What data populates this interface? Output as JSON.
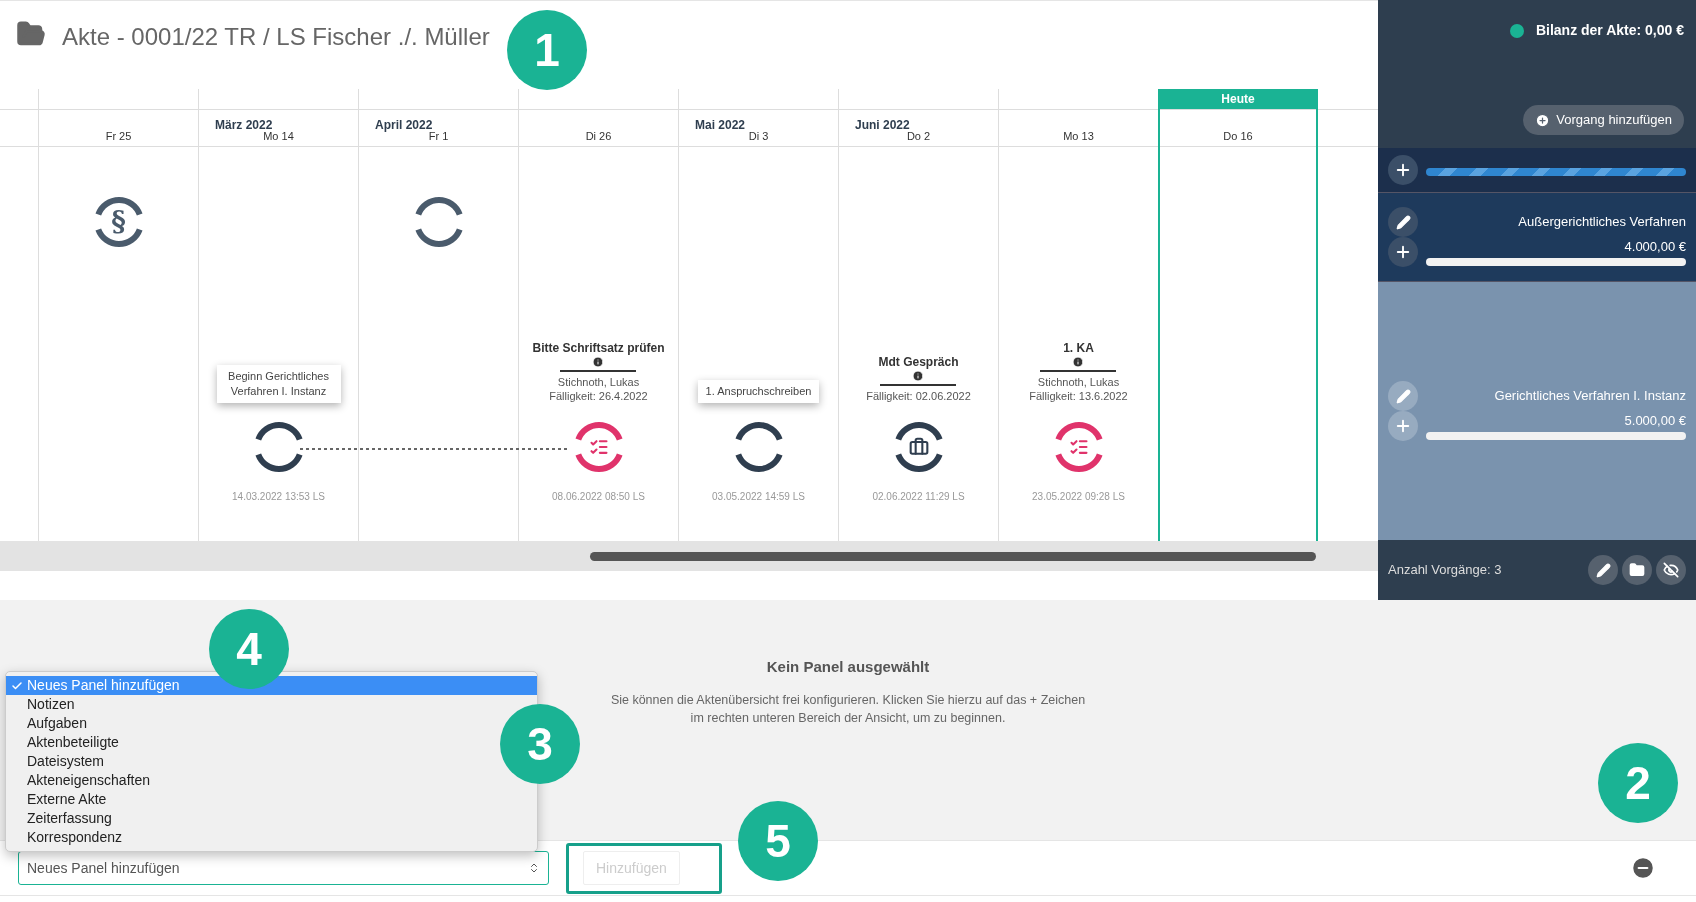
{
  "title": "Akte - 0001/22 TR / LS Fischer ./. Müller",
  "callouts": [
    "1",
    "2",
    "3",
    "4",
    "5"
  ],
  "timeline": {
    "today_label": "Heute",
    "columns": [
      {
        "day": "Fr 25",
        "today": false,
        "marker": {
          "kind": "paragraph",
          "glyph": "§"
        }
      },
      {
        "month": "März 2022",
        "day": "Mo 14",
        "today": false,
        "event": {
          "note": {
            "kind": "tooltip",
            "text": "Beginn Gerichtliches Verfahren I. Instanz"
          },
          "node": {
            "kind": "ring",
            "color": "#2f3e4f"
          },
          "timestamp": "14.03.2022 13:53 LS"
        }
      },
      {
        "month": "April 2022",
        "day": "Fr 1",
        "today": false,
        "marker": {
          "kind": "ring"
        }
      },
      {
        "day": "Di 26",
        "today": false,
        "event": {
          "note": {
            "kind": "task",
            "title": "Bitte Schriftsatz prüfen",
            "lines": [
              "Stichnoth, Lukas",
              "Fälligkeit: 26.4.2022"
            ]
          },
          "node": {
            "kind": "tasks",
            "color": "#e0336b"
          },
          "timestamp": "08.06.2022 08:50 LS"
        }
      },
      {
        "month": "Mai 2022",
        "day": "Di 3",
        "today": false,
        "event": {
          "note": {
            "kind": "tooltip",
            "text": "1. Anspruchschreiben"
          },
          "node": {
            "kind": "ring",
            "color": "#2f3e4f"
          },
          "timestamp": "03.05.2022 14:59 LS"
        }
      },
      {
        "month": "Juni 2022",
        "day": "Do 2",
        "today": false,
        "event": {
          "note": {
            "kind": "task",
            "title": "Mdt Gespräch",
            "lines": [
              "Fälligkeit: 02.06.2022"
            ]
          },
          "node": {
            "kind": "briefcase",
            "color": "#2f3e4f"
          },
          "timestamp": "02.06.2022 11:29 LS"
        }
      },
      {
        "day": "Mo 13",
        "today": false,
        "event": {
          "note": {
            "kind": "task",
            "title": "1. KA",
            "lines": [
              "Stichnoth, Lukas",
              "Fälligkeit: 13.6.2022"
            ]
          },
          "node": {
            "kind": "tasks",
            "color": "#e0336b"
          },
          "timestamp": "23.05.2022 09:28 LS"
        }
      },
      {
        "day": "Do 16",
        "today": true
      }
    ]
  },
  "sidebar": {
    "balance": {
      "color": "#1ab394",
      "label": "Bilanz der Akte: 0,00 €"
    },
    "add_button": "Vorgang hinzufügen",
    "processes": [
      {
        "striped": true,
        "selected": false
      },
      {
        "name": "Außergerichtliches Verfahren",
        "amount": "4.000,00 €",
        "striped": false,
        "selected": false
      },
      {
        "name": "Gerichtliches Verfahren I. Instanz",
        "amount": "5.000,00 €",
        "striped": false,
        "selected": true
      }
    ],
    "count": "Anzahl Vorgänge: 3"
  },
  "empty_state": {
    "title": "Kein Panel ausgewählt",
    "text": "Sie können die Aktenübersicht frei konfigurieren. Klicken Sie hierzu auf das + Zeichen im rechten unteren Bereich der Ansicht, um zu beginnen."
  },
  "panel_picker": {
    "options": [
      {
        "label": "Neues Panel hinzufügen",
        "selected": true
      },
      {
        "label": "Notizen",
        "selected": false
      },
      {
        "label": "Aufgaben",
        "selected": false
      },
      {
        "label": "Aktenbeteiligte",
        "selected": false
      },
      {
        "label": "Dateisystem",
        "selected": false
      },
      {
        "label": "Akteneigenschaften",
        "selected": false
      },
      {
        "label": "Externe Akte",
        "selected": false
      },
      {
        "label": "Zeiterfassung",
        "selected": false
      },
      {
        "label": "Korrespondenz",
        "selected": false
      }
    ],
    "value": "Neues Panel hinzufügen",
    "button": "Hinzufügen",
    "button_disabled": true
  }
}
